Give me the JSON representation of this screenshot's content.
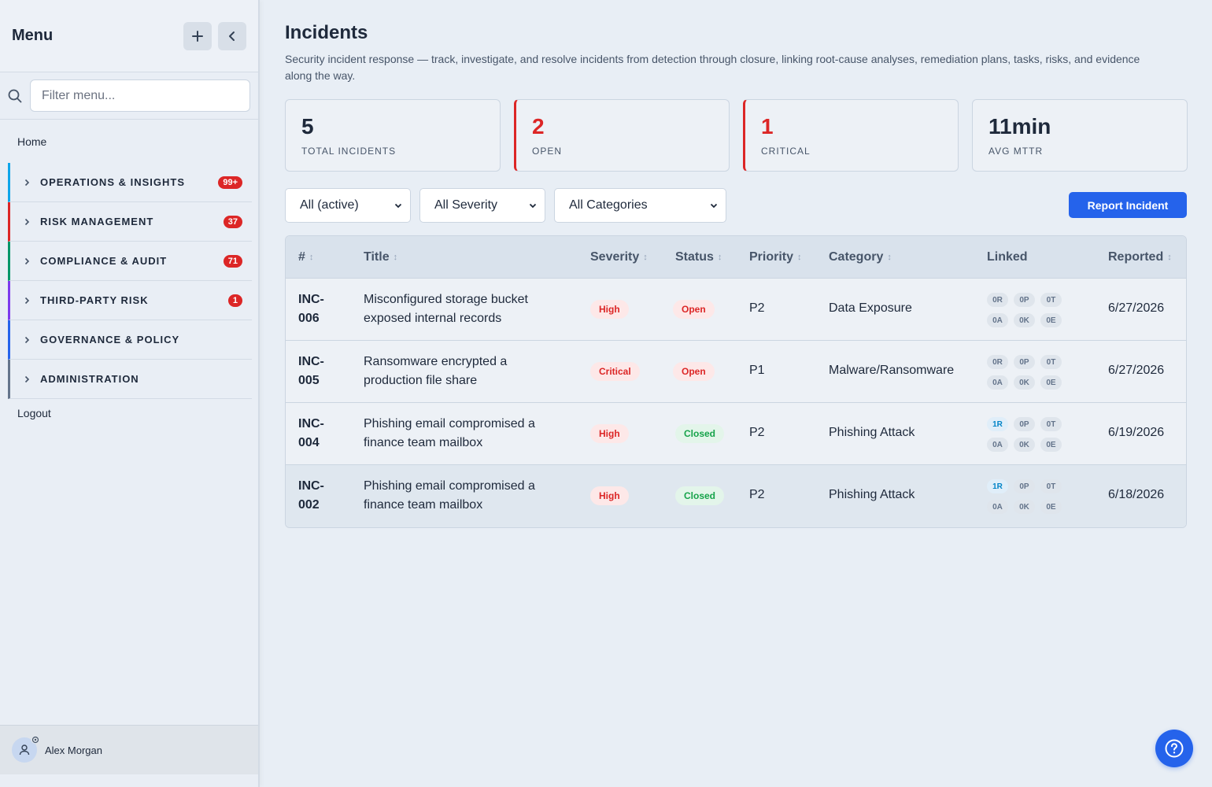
{
  "sidebar": {
    "title": "Menu",
    "filter_placeholder": "Filter menu...",
    "home": "Home",
    "sections": [
      {
        "label": "OPERATIONS & INSIGHTS",
        "badge": "99+",
        "color": "#0ea5e9"
      },
      {
        "label": "RISK MANAGEMENT",
        "badge": "37",
        "color": "#dc2626"
      },
      {
        "label": "COMPLIANCE & AUDIT",
        "badge": "71",
        "color": "#059669"
      },
      {
        "label": "THIRD-PARTY RISK",
        "badge": "1",
        "color": "#7c3aed"
      },
      {
        "label": "GOVERNANCE & POLICY",
        "badge": "",
        "color": "#2563eb"
      },
      {
        "label": "ADMINISTRATION",
        "badge": "",
        "color": "#64748b"
      }
    ],
    "logout": "Logout",
    "user_name": "Alex Morgan"
  },
  "page": {
    "title": "Incidents",
    "description": "Security incident response — track, investigate, and resolve incidents from detection through closure, linking root-cause analyses, remediation plans, tasks, risks, and evidence along the way."
  },
  "stats": [
    {
      "value": "5",
      "label": "TOTAL INCIDENTS"
    },
    {
      "value": "2",
      "label": "OPEN"
    },
    {
      "value": "1",
      "label": "CRITICAL"
    },
    {
      "value": "11min",
      "label": "AVG MTTR"
    }
  ],
  "filters": {
    "status": "All (active)",
    "severity": "All Severity",
    "category": "All Categories"
  },
  "report_button": "Report Incident",
  "table": {
    "headers": {
      "num": "#",
      "title": "Title",
      "severity": "Severity",
      "status": "Status",
      "priority": "Priority",
      "category": "Category",
      "linked": "Linked",
      "reported": "Reported"
    },
    "rows": [
      {
        "num": "INC-006",
        "title": "Misconfigured storage bucket exposed internal records",
        "severity": "High",
        "status": "Open",
        "priority": "P2",
        "category": "Data Exposure",
        "linked": [
          "0R",
          "0P",
          "0T",
          "0A",
          "0K",
          "0E"
        ],
        "reported": "6/27/2026"
      },
      {
        "num": "INC-005",
        "title": "Ransomware encrypted a production file share",
        "severity": "Critical",
        "status": "Open",
        "priority": "P1",
        "category": "Malware/Ransomware",
        "linked": [
          "0R",
          "0P",
          "0T",
          "0A",
          "0K",
          "0E"
        ],
        "reported": "6/27/2026"
      },
      {
        "num": "INC-004",
        "title": "Phishing email compromised a finance team mailbox",
        "severity": "High",
        "status": "Closed",
        "priority": "P2",
        "category": "Phishing Attack",
        "linked": [
          "1R",
          "0P",
          "0T",
          "0A",
          "0K",
          "0E"
        ],
        "reported": "6/19/2026"
      },
      {
        "num": "INC-002",
        "title": "Phishing email compromised a finance team mailbox",
        "severity": "High",
        "status": "Closed",
        "priority": "P2",
        "category": "Phishing Attack",
        "linked": [
          "1R",
          "0P",
          "0T",
          "0A",
          "0K",
          "0E"
        ],
        "reported": "6/18/2026"
      }
    ]
  },
  "icons": {
    "add": "plus-icon",
    "collapse": "chevron-left-icon",
    "search": "search-icon",
    "help": "help-circle-icon",
    "user": "user-icon"
  },
  "colors": {
    "accent": "#2563eb",
    "danger": "#dc2626",
    "success": "#16a34a"
  }
}
